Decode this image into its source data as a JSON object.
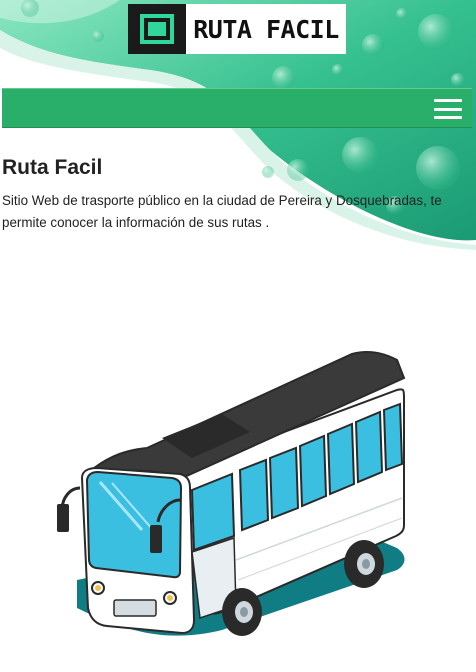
{
  "logo": {
    "text": "RUTA FACIL",
    "icon": "square-logo-icon",
    "accent": "#2fd89a"
  },
  "nav": {
    "menu_icon": "hamburger-menu-icon",
    "color": "#2aaf6b"
  },
  "hero": {
    "gradient_start": "#7fe2b6",
    "gradient_end": "#1b9a74"
  },
  "main": {
    "title": "Ruta Facil",
    "description": "Sitio Web de trasporte público en la ciudad de Pereira y Dosquebradas, te permite conocer la información de sus rutas ."
  },
  "illustration": {
    "icon": "bus-illustration",
    "body_color": "#ffffff",
    "window_color": "#3bbfe0",
    "shadow_color": "#0f7d83"
  }
}
